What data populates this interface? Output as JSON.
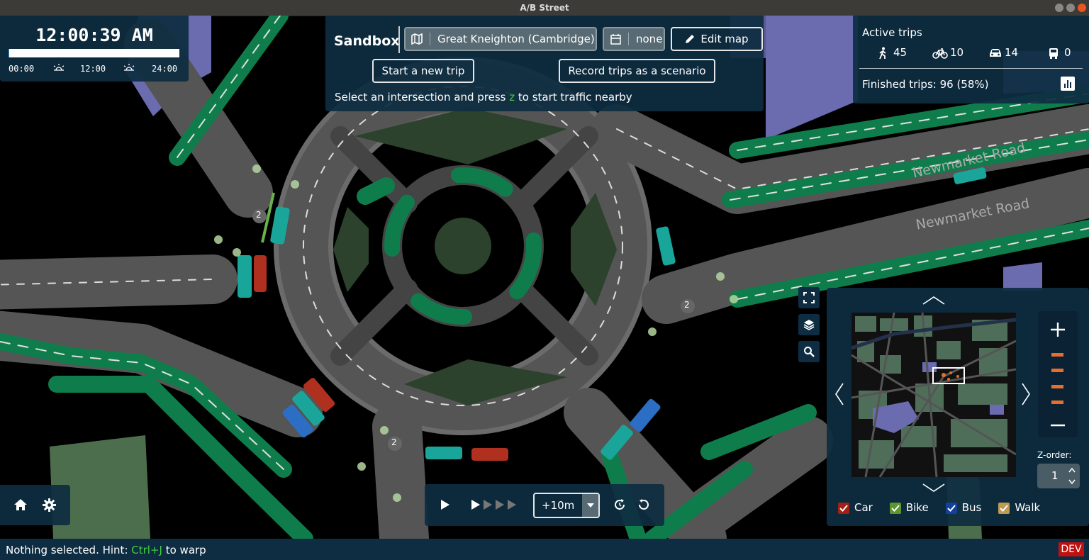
{
  "window": {
    "title": "A/B Street"
  },
  "map": {
    "street_labels": [
      "Newmarket Road",
      "Newmarket Road"
    ],
    "agent_group_counts": [
      "2",
      "2",
      "2"
    ]
  },
  "clock": {
    "time": "12:00:39 AM",
    "progress": 0.0005,
    "tick_start": "00:00",
    "tick_mid": "12:00",
    "tick_end": "24:00",
    "icons": [
      "sunrise-icon",
      "sunset-icon"
    ]
  },
  "sandbox": {
    "title": "Sandbox",
    "map_name": "Great Kneighton (Cambridge)",
    "scenario": "none",
    "edit_map_label": "Edit map",
    "start_trip_label": "Start a new trip",
    "record_label": "Record trips as a scenario",
    "hint_before": "Select an intersection and press ",
    "hint_key": "z",
    "hint_after": " to start traffic nearby"
  },
  "trips": {
    "title": "Active trips",
    "walk": "45",
    "bike": "10",
    "car": "14",
    "bus": "0",
    "finished": "Finished trips: 96 (58%)"
  },
  "speed": {
    "step_label": "+10m"
  },
  "minimap": {
    "zorder_label": "Z-order:",
    "zorder_value": "1",
    "filters": [
      {
        "label": "Car",
        "color": "#a32015"
      },
      {
        "label": "Bike",
        "color": "#5d9630"
      },
      {
        "label": "Bus",
        "color": "#12409d"
      },
      {
        "label": "Walk",
        "color": "#be9a52"
      }
    ]
  },
  "status": {
    "before": "Nothing selected. Hint: ",
    "key": "Ctrl+J",
    "after": " to warp",
    "dev_label": "DEV"
  },
  "colors": {
    "panel": "#0e2d42",
    "road": "#4b4b4b",
    "bike_lane": "#0f7d4b",
    "park": "#2c422c",
    "building": "#6b6bb0",
    "hint_key": "#40d040"
  }
}
